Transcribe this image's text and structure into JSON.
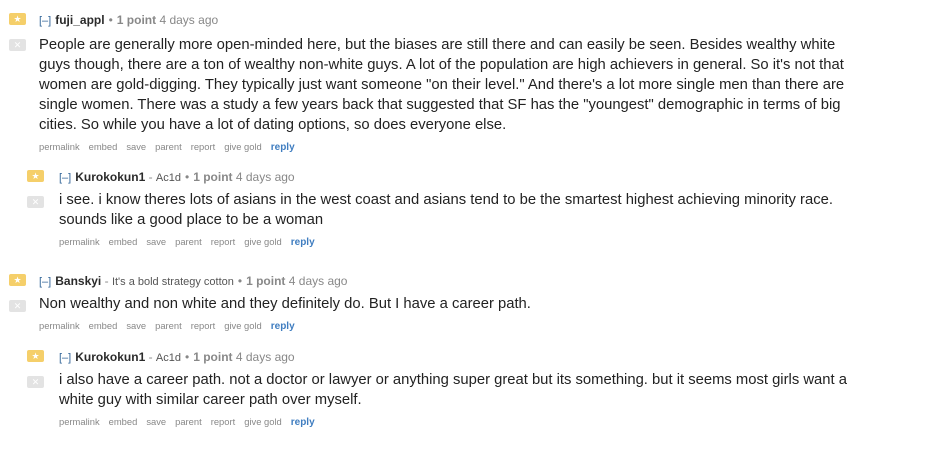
{
  "comments": [
    {
      "collapse": "[–]",
      "author": "fuji_appl",
      "flair": "",
      "score": "1 point",
      "time": "4 days ago",
      "text": "People are generally more open-minded here, but the biases are still there and can easily be seen. Besides wealthy white guys though, there are a ton of wealthy non-white guys. A lot of the population are high achievers in general. So it's not that women are gold-digging. They typically just want someone \"on their level.\" And there's a lot more single men than there are single women. There was a study a few years back that suggested that SF has the \"youngest\" demographic in terms of big cities. So while you have a lot of dating options, so does everyone else.",
      "links": [
        "permalink",
        "embed",
        "save",
        "parent",
        "report",
        "give gold",
        "reply"
      ]
    },
    {
      "collapse": "[–]",
      "author": "Kurokokun1",
      "flair": "Ac1d",
      "score": "1 point",
      "time": "4 days ago",
      "text": "i see. i know theres lots of asians in the west coast and asians tend to be the smartest highest achieving minority race. sounds like a good place to be a woman",
      "links": [
        "permalink",
        "embed",
        "save",
        "parent",
        "report",
        "give gold",
        "reply"
      ]
    },
    {
      "collapse": "[–]",
      "author": "Banskyi",
      "flair": "It's a bold strategy cotton",
      "score": "1 point",
      "time": "4 days ago",
      "text": "Non wealthy and non white and they definitely do. But I have a career path.",
      "links": [
        "permalink",
        "embed",
        "save",
        "parent",
        "report",
        "give gold",
        "reply"
      ]
    },
    {
      "collapse": "[–]",
      "author": "Kurokokun1",
      "flair": "Ac1d",
      "score": "1 point",
      "time": "4 days ago",
      "text": "i also have a career path. not a doctor or lawyer or anything super great but its something. but it seems most girls want a white guy with similar career path over myself.",
      "links": [
        "permalink",
        "embed",
        "save",
        "parent",
        "report",
        "give gold",
        "reply"
      ]
    }
  ]
}
